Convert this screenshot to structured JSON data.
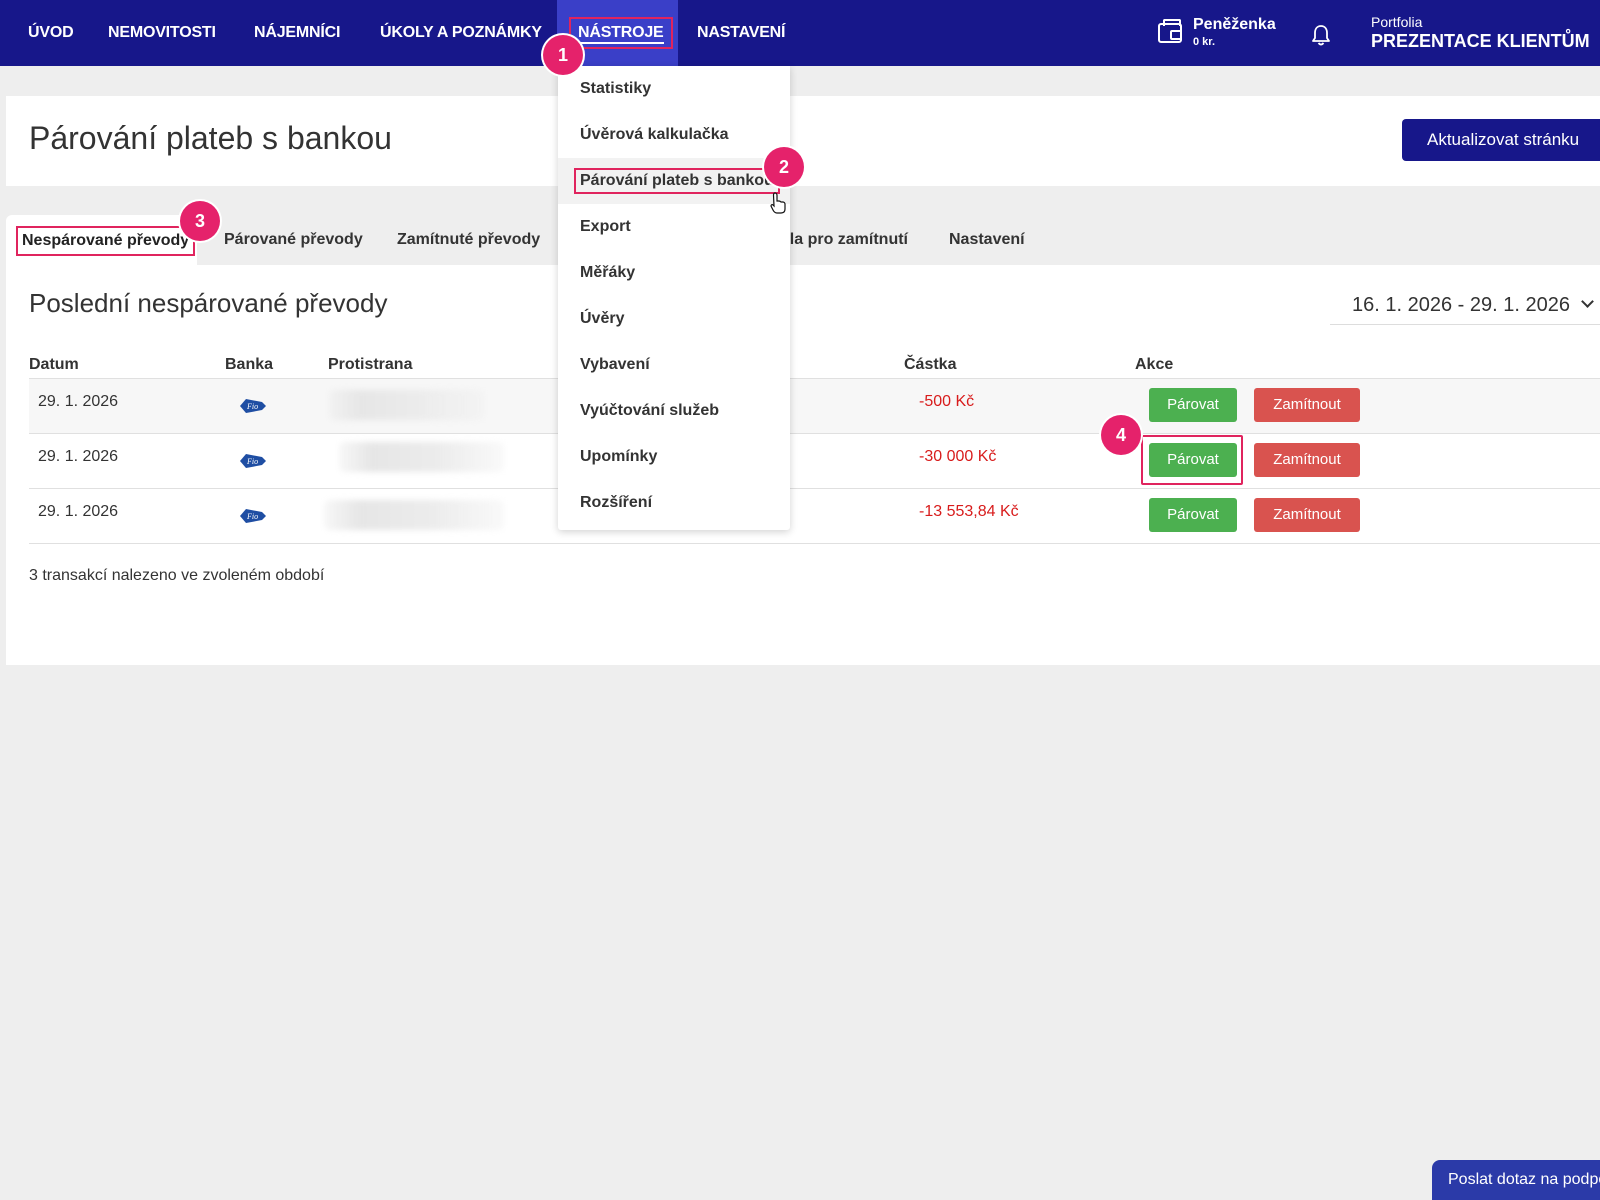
{
  "nav": {
    "items": [
      "ÚVOD",
      "NEMOVITOSTI",
      "NÁJEMNÍCI",
      "ÚKOLY A POZNÁMKY",
      "NÁSTROJE",
      "NASTAVENÍ"
    ],
    "wallet_title": "Peněženka",
    "wallet_amount": "0 kr.",
    "bell_icon": "bell-icon",
    "portfolio_label": "Portfolia",
    "portfolio_name": "PREZENTACE KLIENTŮM"
  },
  "header": {
    "title": "Párování plateb s bankou",
    "refresh_label": "Aktualizovat stránku"
  },
  "tabs": [
    "Nespárované převody",
    "Párované převody",
    "Zamítnuté převody",
    "Pravidla pro zamítnutí",
    "Nastavení"
  ],
  "tab_visible_fragment": "dla pro zamítnutí",
  "section": {
    "title": "Poslední nespárované převody",
    "date_range": "16. 1. 2026 - 29. 1. 2026"
  },
  "table": {
    "headers": [
      "Datum",
      "Banka",
      "Protistrana",
      "Částka",
      "Akce"
    ],
    "rows": [
      {
        "date": "29. 1. 2026",
        "bank": "fio-bank-logo",
        "amount": "-500 Kč"
      },
      {
        "date": "29. 1. 2026",
        "bank": "fio-bank-logo",
        "amount": "-30 000 Kč"
      },
      {
        "date": "29. 1. 2026",
        "bank": "fio-bank-logo",
        "amount": "-13 553,84 Kč"
      }
    ],
    "pair_label": "Párovat",
    "reject_label": "Zamítnout",
    "summary": "3 transakcí nalezeno ve zvoleném období"
  },
  "menu": {
    "items": [
      "Statistiky",
      "Úvěrová kalkulačka",
      "Párování plateb s bankou",
      "Export",
      "Měřáky",
      "Úvěry",
      "Vybavení",
      "Vyúčtování služeb",
      "Upomínky",
      "Rozšíření"
    ]
  },
  "badges": [
    "1",
    "2",
    "3",
    "4"
  ],
  "support_label": "Poslat dotaz na podporu",
  "colors": {
    "nav_bg": "#17178a",
    "nav_active": "#3a3fc8",
    "highlight": "#e0245e",
    "pair_button": "#4cb050",
    "reject_button": "#d9534f",
    "amount_negative": "#d81c1c"
  }
}
